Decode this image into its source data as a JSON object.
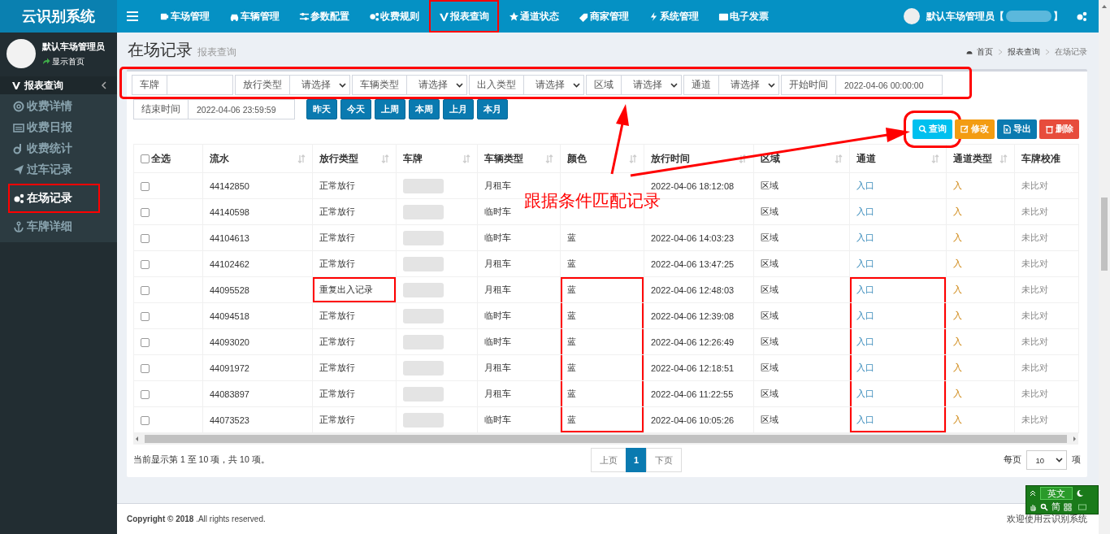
{
  "header": {
    "logo": "云识别系统",
    "nav": [
      {
        "label": "车场管理",
        "highlighted": false
      },
      {
        "label": "车辆管理",
        "highlighted": false
      },
      {
        "label": "参数配置",
        "highlighted": false
      },
      {
        "label": "收费规则",
        "highlighted": false
      },
      {
        "label": "报表查询",
        "highlighted": true
      },
      {
        "label": "通道状态",
        "highlighted": false
      },
      {
        "label": "商家管理",
        "highlighted": false
      },
      {
        "label": "系统管理",
        "highlighted": false
      },
      {
        "label": "电子发票",
        "highlighted": false
      }
    ],
    "user": {
      "name": "默认车场管理员【",
      "suffix": "】"
    }
  },
  "sidebar": {
    "user": {
      "name": "默认车场管理员",
      "link": "显示首页"
    },
    "section": "报表查询",
    "items": [
      {
        "label": "收费详情",
        "selected": false,
        "highlighted": false
      },
      {
        "label": "收费日报",
        "selected": false,
        "highlighted": false
      },
      {
        "label": "收费统计",
        "selected": false,
        "highlighted": false
      },
      {
        "label": "过车记录",
        "selected": false,
        "highlighted": false
      },
      {
        "label": "在场记录",
        "selected": true,
        "highlighted": true
      },
      {
        "label": "车牌详细",
        "selected": false,
        "highlighted": false
      }
    ]
  },
  "page": {
    "title": "在场记录",
    "subtitle": "报表查询",
    "breadcrumb": [
      "首页",
      "报表查询",
      "在场记录"
    ]
  },
  "filters": {
    "highlighted": true,
    "fields": [
      {
        "kind": "text",
        "label": "车牌"
      },
      {
        "kind": "select",
        "label": "放行类型",
        "value": "请选择"
      },
      {
        "kind": "select",
        "label": "车辆类型",
        "value": "请选择"
      },
      {
        "kind": "select",
        "label": "出入类型",
        "value": "请选择"
      },
      {
        "kind": "select",
        "label": "区域",
        "value": "请选择"
      },
      {
        "kind": "select",
        "label": "通道",
        "value": "请选择"
      },
      {
        "kind": "text",
        "label": "开始时间",
        "value": "2022-04-06 00:00:00"
      }
    ],
    "end_time": {
      "label": "结束时间",
      "value": "2022-04-06 23:59:59"
    },
    "quick_ranges": [
      "昨天",
      "今天",
      "上周",
      "本周",
      "上月",
      "本月"
    ]
  },
  "actions": [
    {
      "kind": "info",
      "label": "查询",
      "highlighted": true
    },
    {
      "kind": "warning",
      "label": "修改",
      "highlighted": false
    },
    {
      "kind": "primary",
      "label": "导出",
      "highlighted": false
    },
    {
      "kind": "danger",
      "label": "删除",
      "highlighted": false
    }
  ],
  "table": {
    "select_all": {
      "label": "全选",
      "checked": false
    },
    "columns": [
      {
        "label": "流水",
        "sortable": true,
        "kind": "plain"
      },
      {
        "label": "放行类型",
        "sortable": true,
        "kind": "plain"
      },
      {
        "label": "车牌",
        "sortable": true,
        "kind": "redacted"
      },
      {
        "label": "车辆类型",
        "sortable": true,
        "kind": "plain"
      },
      {
        "label": "颜色",
        "sortable": true,
        "kind": "plain"
      },
      {
        "label": "放行时间",
        "sortable": true,
        "kind": "plain"
      },
      {
        "label": "区域",
        "sortable": true,
        "kind": "plain"
      },
      {
        "label": "通道",
        "sortable": true,
        "kind": "link"
      },
      {
        "label": "通道类型",
        "sortable": true,
        "kind": "accent"
      },
      {
        "label": "车牌校准",
        "sortable": false,
        "kind": "muted"
      }
    ],
    "rows": [
      {
        "checked": false,
        "serial": "44142850",
        "release_type": "正常放行",
        "vehicle_type": "月租车",
        "time": "2022-04-06 18:12:08",
        "area": "区域",
        "channel": "入口",
        "channel_type": "入",
        "plate_check": "未比对",
        "marked": {
          "release_type": false,
          "color": false,
          "channel": false
        }
      },
      {
        "checked": false,
        "serial": "44140598",
        "release_type": "正常放行",
        "vehicle_type": "临时车",
        "area": "区域",
        "channel": "入口",
        "channel_type": "入",
        "plate_check": "未比对",
        "marked": {
          "release_type": false,
          "color": false,
          "channel": false
        }
      },
      {
        "checked": false,
        "serial": "44104613",
        "release_type": "正常放行",
        "vehicle_type": "临时车",
        "plate_color": "蓝",
        "time": "2022-04-06 14:03:23",
        "area": "区域",
        "channel": "入口",
        "channel_type": "入",
        "plate_check": "未比对",
        "marked": {
          "release_type": false,
          "color": false,
          "channel": false
        }
      },
      {
        "checked": false,
        "serial": "44102462",
        "release_type": "正常放行",
        "vehicle_type": "月租车",
        "plate_color": "蓝",
        "time": "2022-04-06 13:47:25",
        "area": "区域",
        "channel": "入口",
        "channel_type": "入",
        "plate_check": "未比对",
        "marked": {
          "release_type": false,
          "color": false,
          "channel": false
        }
      },
      {
        "checked": false,
        "serial": "44095528",
        "release_type": "重复出入记录",
        "vehicle_type": "月租车",
        "plate_color": "蓝",
        "time": "2022-04-06 12:48:03",
        "area": "区域",
        "channel": "入口",
        "channel_type": "入",
        "plate_check": "未比对",
        "marked": {
          "release_type": true,
          "color": true,
          "channel": true
        }
      },
      {
        "checked": false,
        "serial": "44094518",
        "release_type": "正常放行",
        "vehicle_type": "临时车",
        "plate_color": "蓝",
        "time": "2022-04-06 12:39:08",
        "area": "区域",
        "channel": "入口",
        "channel_type": "入",
        "plate_check": "未比对",
        "marked": {
          "release_type": false,
          "color": true,
          "channel": true
        }
      },
      {
        "checked": false,
        "serial": "44093020",
        "release_type": "正常放行",
        "vehicle_type": "临时车",
        "plate_color": "蓝",
        "time": "2022-04-06 12:26:49",
        "area": "区域",
        "channel": "入口",
        "channel_type": "入",
        "plate_check": "未比对",
        "marked": {
          "release_type": false,
          "color": true,
          "channel": true
        }
      },
      {
        "checked": false,
        "serial": "44091972",
        "release_type": "正常放行",
        "vehicle_type": "月租车",
        "plate_color": "蓝",
        "time": "2022-04-06 12:18:51",
        "area": "区域",
        "channel": "入口",
        "channel_type": "入",
        "plate_check": "未比对",
        "marked": {
          "release_type": false,
          "color": true,
          "channel": true
        }
      },
      {
        "checked": false,
        "serial": "44083897",
        "release_type": "正常放行",
        "vehicle_type": "月租车",
        "plate_color": "蓝",
        "time": "2022-04-06 11:22:55",
        "area": "区域",
        "channel": "入口",
        "channel_type": "入",
        "plate_check": "未比对",
        "marked": {
          "release_type": false,
          "color": true,
          "channel": true
        }
      },
      {
        "checked": false,
        "serial": "44073523",
        "release_type": "正常放行",
        "vehicle_type": "临时车",
        "plate_color": "蓝",
        "time": "2022-04-06 10:05:26",
        "area": "区域",
        "channel": "入口",
        "channel_type": "入",
        "plate_check": "未比对",
        "marked": {
          "release_type": false,
          "color": true,
          "channel": true
        }
      }
    ]
  },
  "pagination": {
    "info": "当前显示第 1 至 10 项，共 10 项。",
    "pages": [
      {
        "label": "上页",
        "kind": "nav",
        "selected": false
      },
      {
        "label": "1",
        "kind": "page",
        "selected": true
      },
      {
        "label": "下页",
        "kind": "nav",
        "selected": false
      }
    ],
    "per_page_label": "每页",
    "per_page": "10",
    "unit": "项"
  },
  "annotation": {
    "text": "跟据条件匹配记录"
  },
  "footer": {
    "copyright": "**Copyright © 2018** .All rights reserved.",
    "welcome": "欢迎使用云识别系统"
  },
  "ime": {
    "mode": "英文",
    "script": "简"
  }
}
